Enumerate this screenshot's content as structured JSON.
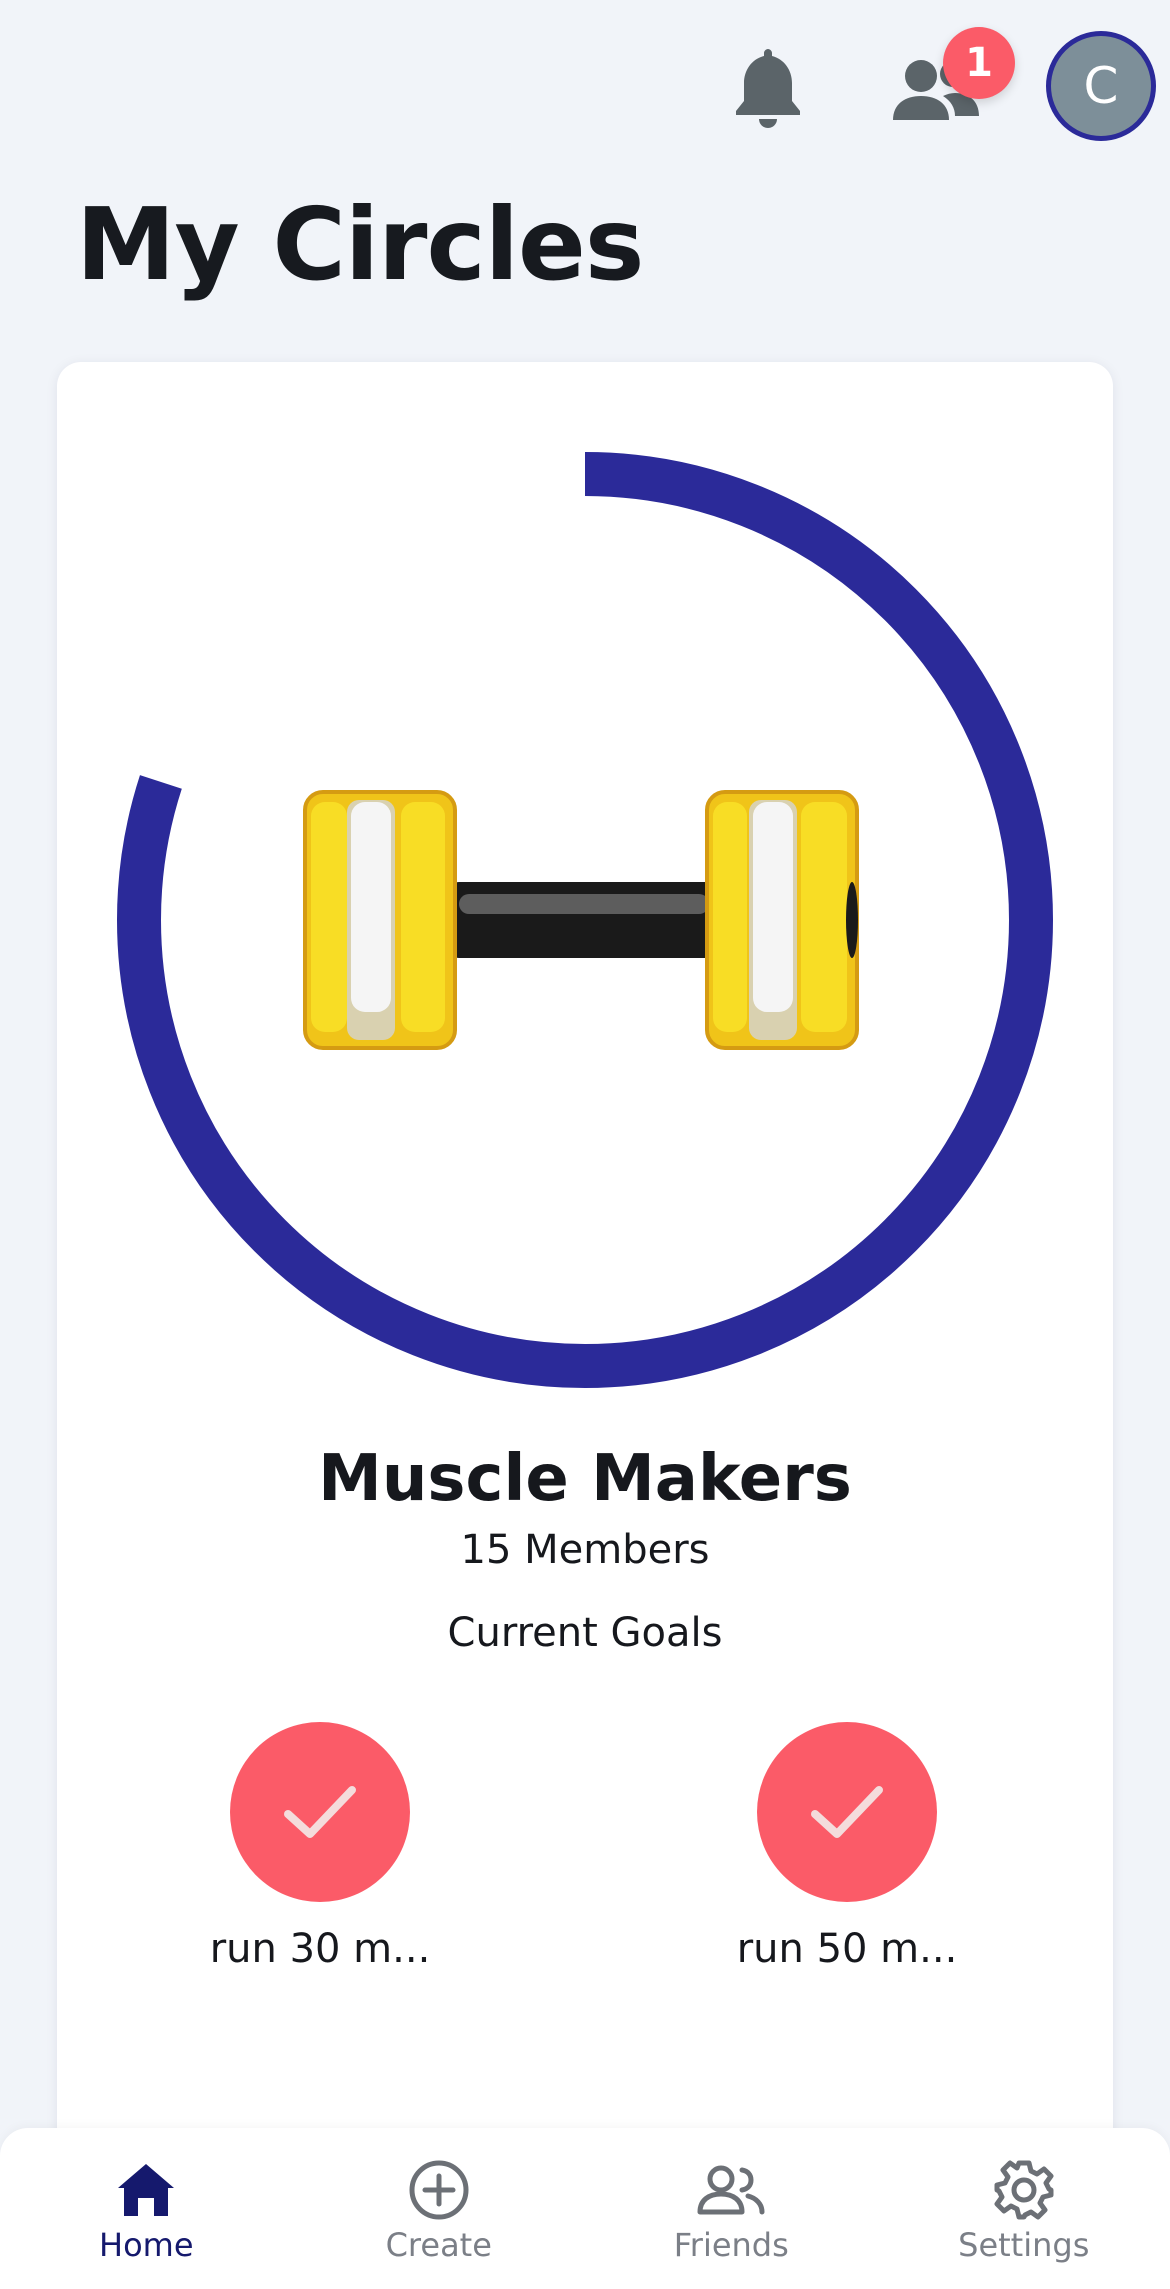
{
  "header": {
    "notifications_icon": "bell-icon",
    "friends_icon": "people-icon",
    "friend_request_badge": "1",
    "avatar_initial": "C"
  },
  "page": {
    "title": "My Circles"
  },
  "circle": {
    "name": "Muscle Makers",
    "members": "15 Members",
    "goals_heading": "Current Goals",
    "image": "dumbbell",
    "progress_fraction": 0.8,
    "goals": [
      {
        "label": "run 30 m...",
        "status": "complete"
      },
      {
        "label": "run 50 m...",
        "status": "complete"
      }
    ]
  },
  "nav": {
    "items": [
      {
        "label": "Home",
        "icon": "home-icon",
        "active": true
      },
      {
        "label": "Create",
        "icon": "plus-circle-icon",
        "active": false
      },
      {
        "label": "Friends",
        "icon": "people-icon",
        "active": false
      },
      {
        "label": "Settings",
        "icon": "gear-icon",
        "active": false
      }
    ]
  },
  "colors": {
    "accent": "#2b2a99",
    "goal": "#fb5b68",
    "background": "#f1f4f9",
    "nav_active": "#15196d",
    "nav_inactive": "#7b7f87"
  }
}
